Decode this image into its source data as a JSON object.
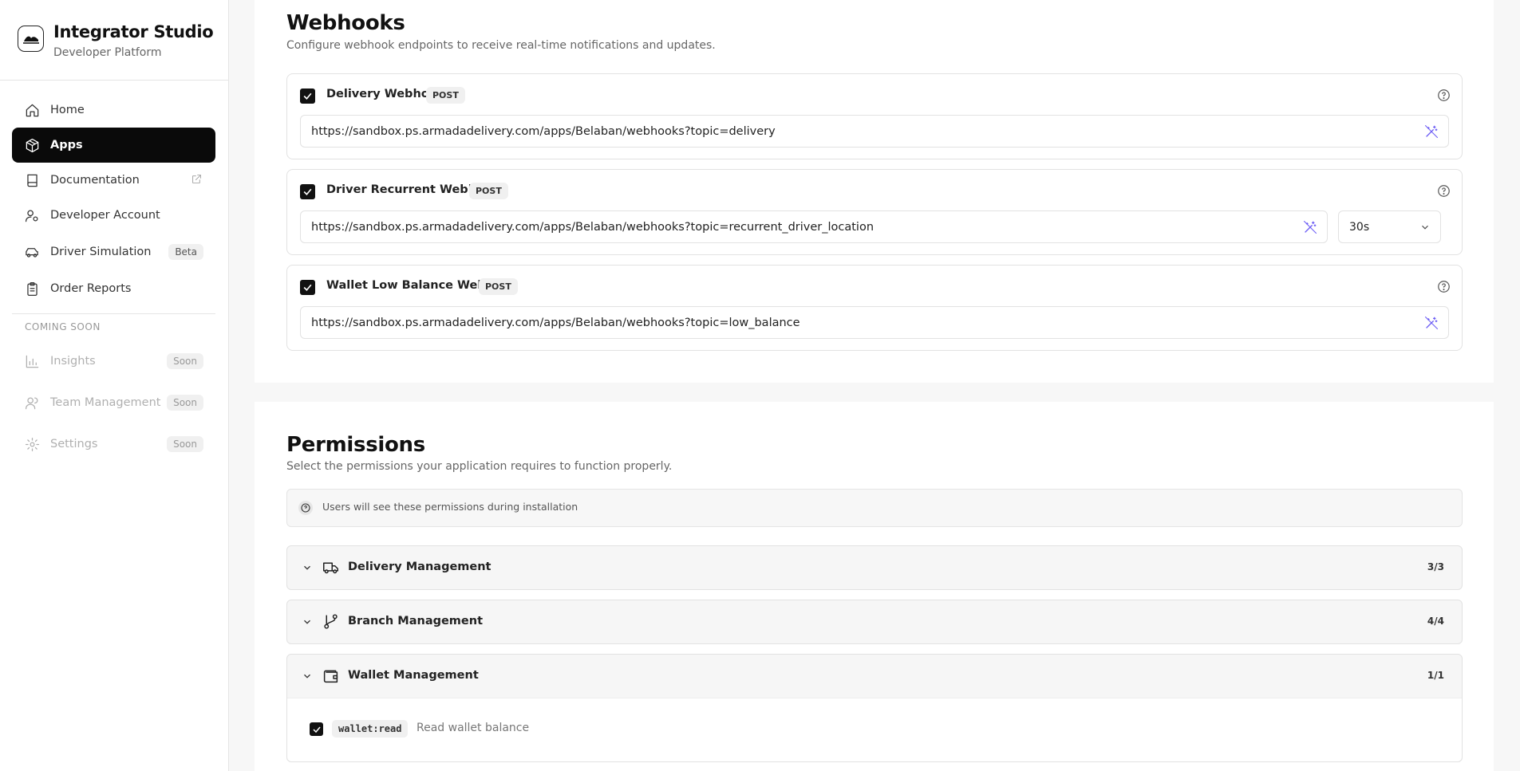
{
  "brand": {
    "name": "Integrator Studio",
    "subtitle": "Developer Platform"
  },
  "sidebar": {
    "items": [
      {
        "label": "Home",
        "icon": "home-icon"
      },
      {
        "label": "Apps",
        "icon": "package-icon",
        "active": true
      },
      {
        "label": "Documentation",
        "icon": "book-icon",
        "external": true
      },
      {
        "label": "Developer Account",
        "icon": "user-cog-icon"
      },
      {
        "label": "Driver Simulation",
        "icon": "car-icon",
        "badge": "Beta"
      },
      {
        "label": "Order Reports",
        "icon": "clipboard-icon"
      }
    ],
    "section_label": "COMING SOON",
    "soon_items": [
      {
        "label": "Insights",
        "icon": "bar-chart-icon",
        "badge": "Soon"
      },
      {
        "label": "Team Management",
        "icon": "users-icon",
        "badge": "Soon"
      },
      {
        "label": "Settings",
        "icon": "gear-icon",
        "badge": "Soon"
      }
    ]
  },
  "webhooks": {
    "title": "Webhooks",
    "description": "Configure webhook endpoints to receive real-time notifications and updates.",
    "items": [
      {
        "name": "Delivery Webhook",
        "method": "POST",
        "checked": true,
        "url": "https://sandbox.ps.armadadelivery.com/apps/Belaban/webhooks?topic=delivery"
      },
      {
        "name": "Driver Recurrent Webhook",
        "method": "POST",
        "checked": true,
        "url": "https://sandbox.ps.armadadelivery.com/apps/Belaban/webhooks?topic=recurrent_driver_location",
        "interval": "30s"
      },
      {
        "name": "Wallet Low Balance Webhook",
        "method": "POST",
        "checked": true,
        "url": "https://sandbox.ps.armadadelivery.com/apps/Belaban/webhooks?topic=low_balance"
      }
    ]
  },
  "permissions": {
    "title": "Permissions",
    "description": "Select the permissions your application requires to function properly.",
    "info": "Users will see these permissions during installation",
    "groups": [
      {
        "title": "Delivery Management",
        "count": "3/3",
        "icon": "truck-icon",
        "expanded": false
      },
      {
        "title": "Branch Management",
        "count": "4/4",
        "icon": "git-branch-icon",
        "expanded": false
      },
      {
        "title": "Wallet Management",
        "count": "1/1",
        "icon": "wallet-icon",
        "expanded": true,
        "scopes": [
          {
            "code": "wallet:read",
            "description": "Read wallet balance",
            "checked": true
          }
        ]
      }
    ]
  },
  "colors": {
    "accent": "#6d5ef5",
    "active_nav": "#0a0a0a"
  }
}
